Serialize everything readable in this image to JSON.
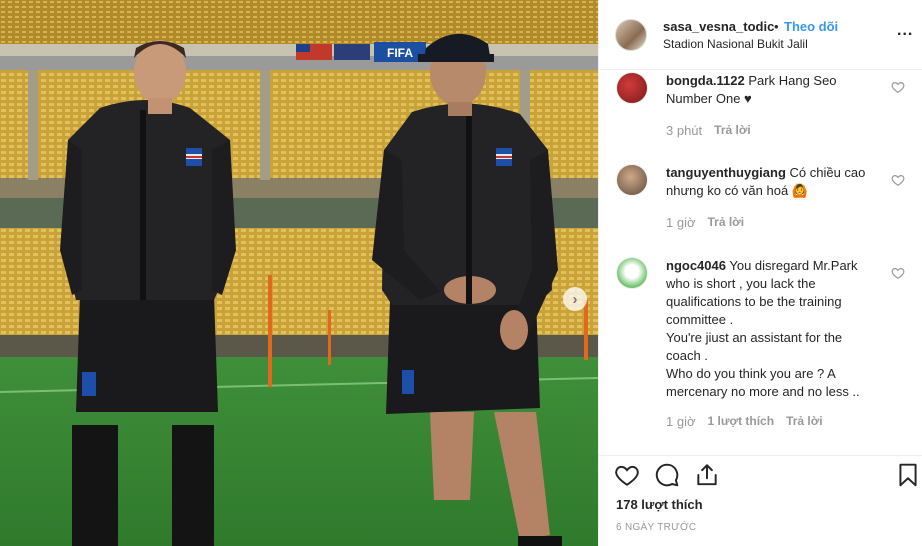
{
  "photo": {
    "banner_text": "FIFA",
    "next_icon": "chevron-right-icon"
  },
  "header": {
    "username": "sasa_vesna_todic",
    "separator": "•",
    "follow_label": "Theo dõi",
    "location": "Stadion Nasional Bukit Jalil",
    "more_icon": "more-options-icon",
    "more_label": "..."
  },
  "comments": [
    {
      "username": "bongda.1122",
      "lines": [
        "Park Hang Seo",
        "Number One ♥"
      ],
      "time": "3 phút",
      "likes": "",
      "reply": "Trả lời"
    },
    {
      "username": "tanguyenthuygiang",
      "lines": [
        "Có chiều cao",
        "nhưng ko có văn hoá 🙆"
      ],
      "time": "1 giờ",
      "likes": "",
      "reply": "Trả lời"
    },
    {
      "username": "ngoc4046",
      "lines": [
        "You disregard Mr.Park",
        "who is short , you lack the",
        "qualifications to be the training",
        "committee .",
        "You're jiust an assistant for the",
        "coach .",
        "Who do you think you are ? A",
        "mercenary no more and no less .."
      ],
      "time": "1 giờ",
      "likes": "1 lượt thích",
      "reply": "Trả lời"
    }
  ],
  "actions": {
    "like_icon": "heart-icon",
    "comment_icon": "comment-icon",
    "share_icon": "share-icon",
    "save_icon": "bookmark-icon",
    "likes_count": "178 lượt thích",
    "date": "6 NGÀY TRƯỚC"
  },
  "colors": {
    "link": "#3897f0",
    "text": "#262626",
    "muted": "#999999",
    "border": "#efefef"
  }
}
